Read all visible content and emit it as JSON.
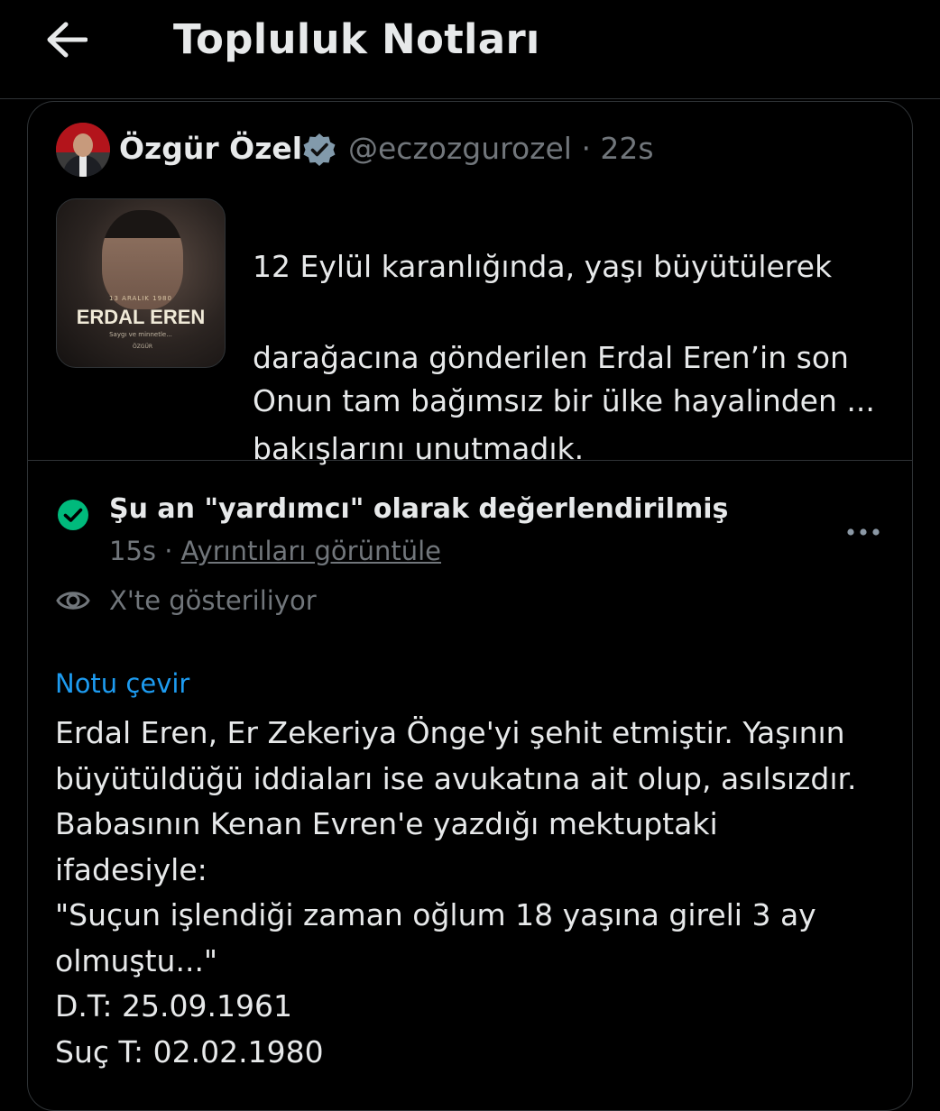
{
  "header": {
    "title": "Topluluk Notları",
    "back_icon": "arrow-left-icon"
  },
  "tweet": {
    "author_name": "Özgür Özel",
    "verified_icon": "verified-badge-icon",
    "handle": "@eczozgurozel · 22s",
    "lines": [
      "12 Eylül karanlığında, yaşı büyütülerek",
      "darağacına gönderilen Erdal Eren’in son",
      "bakışlarını unutmadık."
    ],
    "more_line": "Onun tam bağımsız bir ülke hayalinden ...",
    "thumbnail": {
      "small_text": "13 ARALIK 1980",
      "title": "ERDAL EREN",
      "subtitle": "Saygı ve minnetle...",
      "logo_text": "ÖZGÜR"
    }
  },
  "note": {
    "status_title": "Şu an \"yardımcı\" olarak değerlendirilmiş",
    "status_icon": "check-circle-icon",
    "status_color": "#00ba7c",
    "time": "15s",
    "separator": " · ",
    "details_link": "Ayrıntıları görüntüle",
    "more_icon": "more-horizontal-icon",
    "shown_icon": "eye-icon",
    "shown_text": "X'te gösteriliyor",
    "translate_link": "Notu çevir",
    "link_color": "#1d9bf0",
    "lines": [
      "Erdal Eren, Er Zekeriya Önge'yi şehit etmiştir. Yaşının",
      "büyütüldüğü iddiaları ise avukatına ait olup, asılsızdır.",
      "Babasının Kenan Evren'e yazdığı mektuptaki",
      "ifadesiyle:",
      "\"Suçun işlendiği zaman oğlum 18 yaşına gireli 3 ay",
      "olmuştu...\"",
      "D.T: 25.09.1961",
      "Suç T: 02.02.1980"
    ]
  }
}
